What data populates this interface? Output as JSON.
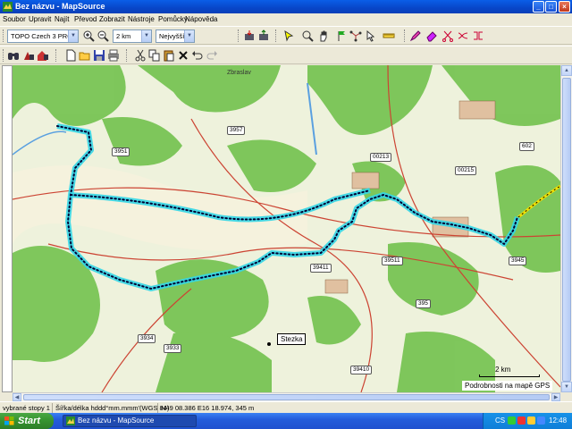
{
  "window": {
    "title": "Bez názvu - MapSource"
  },
  "menu": [
    "Soubor",
    "Upravit",
    "Najít",
    "Převod",
    "Zobrazit",
    "Nástroje",
    "Pomůcky",
    "Nápověda"
  ],
  "toolbar": {
    "map_product": "TOPO Czech 3 PRO",
    "zoom_scale": "2 km",
    "detail_level": "Nejvyšší"
  },
  "map": {
    "labels": [
      "Zbraslav",
      "Stezka"
    ],
    "road_numbers": [
      "3957",
      "3951",
      "00213",
      "00215",
      "39411",
      "39511",
      "395",
      "3934",
      "3933",
      "39410",
      "3945",
      "602"
    ],
    "waypoint": "Stezka",
    "scale_label": "2 km",
    "gps_detail_label": "Podrobnosti na mapě GPS"
  },
  "status": {
    "selection": "vybrané stopy 1",
    "format": "Šířka/délka hddd°mm.mmm'(WGS 84)",
    "position": "N49 08.386 E16 18.974, 345 m"
  },
  "taskbar": {
    "start": "Start",
    "task": "Bez názvu - MapSource",
    "language": "CS",
    "clock": "12:48"
  },
  "colors": {
    "track": "#33d6e6",
    "title_bar": "#0a5ee8",
    "forest": "#6fc04a"
  }
}
